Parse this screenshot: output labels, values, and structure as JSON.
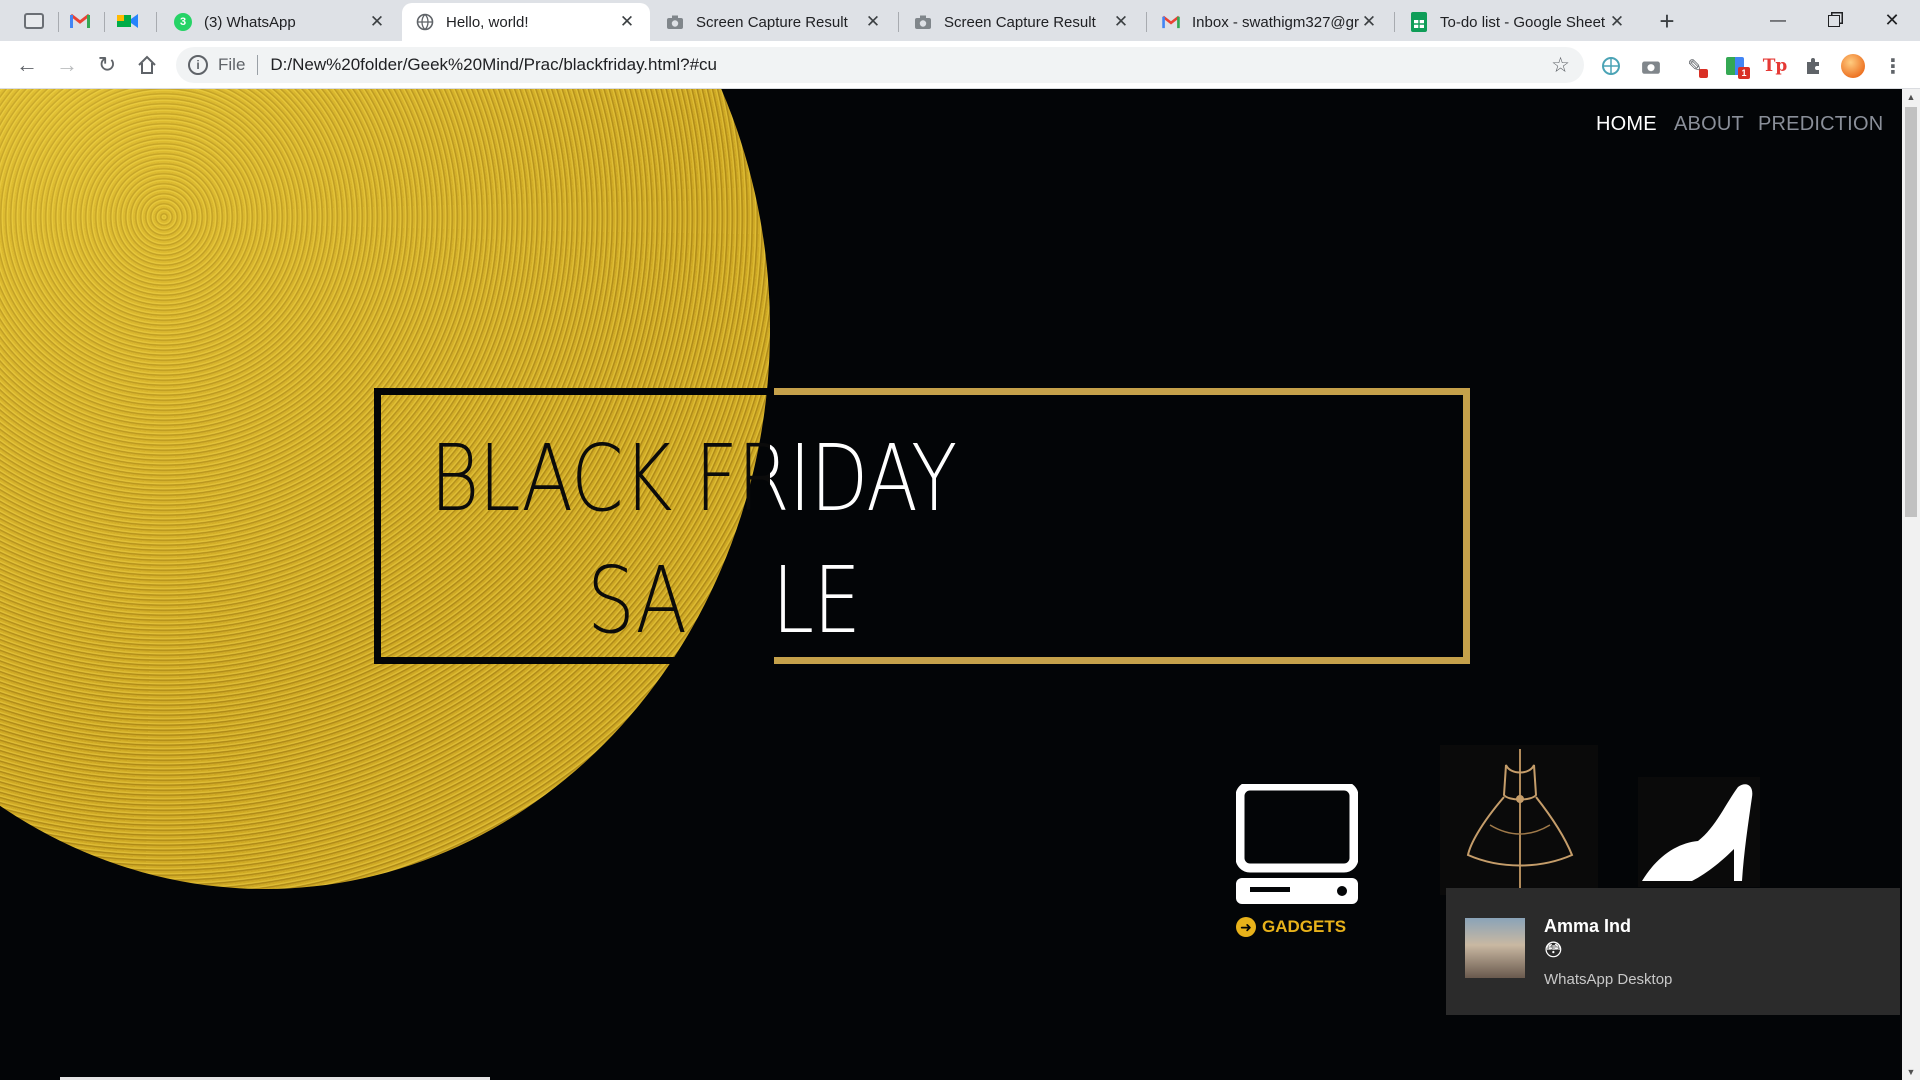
{
  "browser": {
    "pinned_tabs": [
      {
        "icon": "pinned-app-icon"
      },
      {
        "icon": "gmail-icon"
      },
      {
        "icon": "google-meet-icon"
      }
    ],
    "tabs": [
      {
        "title": "(3) WhatsApp",
        "icon": "whatsapp-icon",
        "badge": "3"
      },
      {
        "title": "Hello, world!",
        "icon": "globe-icon",
        "active": true
      },
      {
        "title": "Screen Capture Result",
        "icon": "camera-icon"
      },
      {
        "title": "Screen Capture Result",
        "icon": "camera-icon"
      },
      {
        "title": "Inbox - swathigm327@gr",
        "icon": "gmail-icon"
      },
      {
        "title": "To-do list - Google Sheet",
        "icon": "google-sheets-icon"
      }
    ],
    "url_scheme": "File",
    "url": "D:/New%20folder/Geek%20Mind/Prac/blackfriday.html?#cu",
    "extensions": [
      "globe-ext-icon",
      "camera-ext-icon",
      "tools-ext-icon",
      "translate-ext-icon",
      "tp-ext-icon",
      "puzzle-ext-icon",
      "profile-avatar"
    ],
    "tp_label": "Tp"
  },
  "page": {
    "nav": [
      "HOME",
      "ABOUT",
      "PREDICTION"
    ],
    "headline_line1": "BLACK FRIDAY",
    "headline_line2_left": "SA",
    "headline_line2_right": "LE",
    "categories": [
      {
        "icon": "computer-icon",
        "label": "GADGETS"
      },
      {
        "icon": "dress-icon"
      },
      {
        "icon": "high-heel-icon"
      }
    ],
    "colors": {
      "background": "#030507",
      "gold": "#c5a14a",
      "accent": "#e8b21a"
    }
  },
  "notification": {
    "sender": "Amma Ind",
    "message": "😳",
    "app": "WhatsApp Desktop"
  }
}
